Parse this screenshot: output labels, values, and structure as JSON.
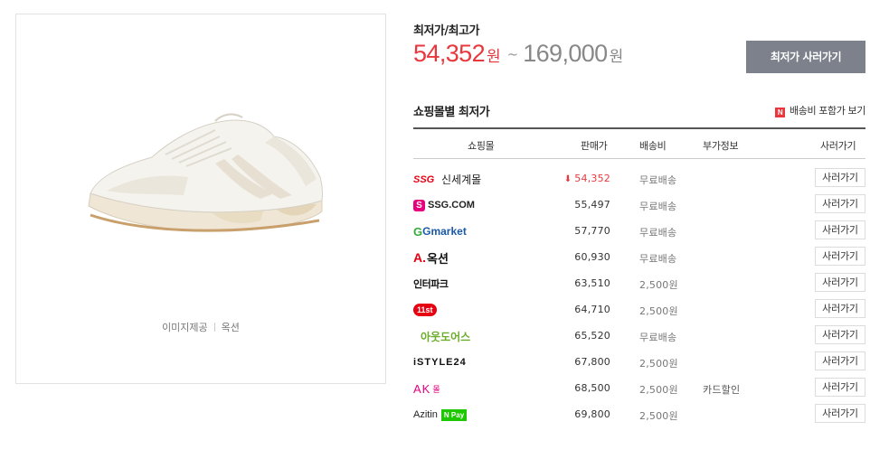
{
  "image": {
    "credit_label": "이미지제공",
    "credit_source": "옥션"
  },
  "price": {
    "label": "최저가/최고가",
    "low": "54,352",
    "low_unit": "원",
    "tilde": "~",
    "high": "169,000",
    "high_unit": "원",
    "buy_lowest_label": "최저가 사러가기"
  },
  "mall_section": {
    "title": "쇼핑몰별 최저가",
    "shipping_badge": "N",
    "shipping_toggle": "배송비 포함가 보기",
    "headers": {
      "mall": "쇼핑몰",
      "price": "판매가",
      "shipping": "배송비",
      "extra": "부가정보",
      "buy": "사러가기"
    },
    "rows": [
      {
        "mall": "신세계몰",
        "logo_text": "SSG",
        "price": "54,352",
        "shipping": "무료배송",
        "extra": "",
        "buy": "사러가기",
        "lowest": true,
        "arrow": "⬇"
      },
      {
        "mall": "SSG.COM",
        "logo_text": "S",
        "price": "55,497",
        "shipping": "무료배송",
        "extra": "",
        "buy": "사러가기"
      },
      {
        "mall": "Gmarket",
        "logo_text": "G",
        "price": "57,770",
        "shipping": "무료배송",
        "extra": "",
        "buy": "사러가기"
      },
      {
        "mall": "옥션",
        "logo_text": "A.",
        "price": "60,930",
        "shipping": "무료배송",
        "extra": "",
        "buy": "사러가기"
      },
      {
        "mall": "인터파크",
        "logo_text": "",
        "price": "63,510",
        "shipping": "2,500원",
        "extra": "",
        "buy": "사러가기"
      },
      {
        "mall": "11st",
        "logo_text": "11st",
        "price": "64,710",
        "shipping": "2,500원",
        "extra": "",
        "buy": "사러가기"
      },
      {
        "mall": "아웃도어스",
        "logo_text": "",
        "price": "65,520",
        "shipping": "무료배송",
        "extra": "",
        "buy": "사러가기"
      },
      {
        "mall": "iSTYLE24",
        "logo_text": "",
        "price": "67,800",
        "shipping": "2,500원",
        "extra": "",
        "buy": "사러가기"
      },
      {
        "mall": "AK몰",
        "logo_text": "AK",
        "logo_suffix": "몰",
        "price": "68,500",
        "shipping": "2,500원",
        "extra": "카드할인",
        "buy": "사러가기"
      },
      {
        "mall": "Azitin",
        "logo_text": "Azitin",
        "npay": "N Pay",
        "price": "69,800",
        "shipping": "2,500원",
        "extra": "",
        "buy": "사러가기"
      }
    ]
  },
  "colors": {
    "accent_red": "#e8383d",
    "button_gray": "#7c818c",
    "gmarket_green": "#38a93a",
    "ak_pink": "#e4007f",
    "outdoors_green": "#6bad2a"
  }
}
